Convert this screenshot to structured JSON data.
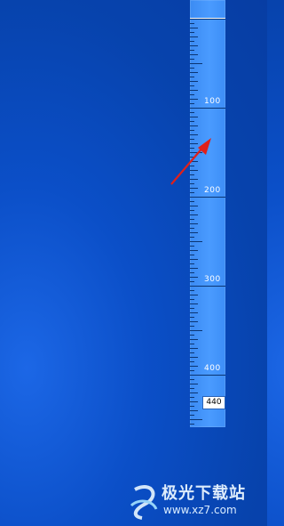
{
  "ruler": {
    "labels": [
      "100",
      "200",
      "300",
      "400"
    ],
    "readout": "440",
    "color": "#4a9bff"
  },
  "cursor": {
    "icon": "red-arrow-icon",
    "color": "#e0201a"
  },
  "watermark": {
    "logo_text": "极光下载站",
    "url": "www.xz7.com"
  },
  "background": {
    "color": "#0a4cc0"
  }
}
